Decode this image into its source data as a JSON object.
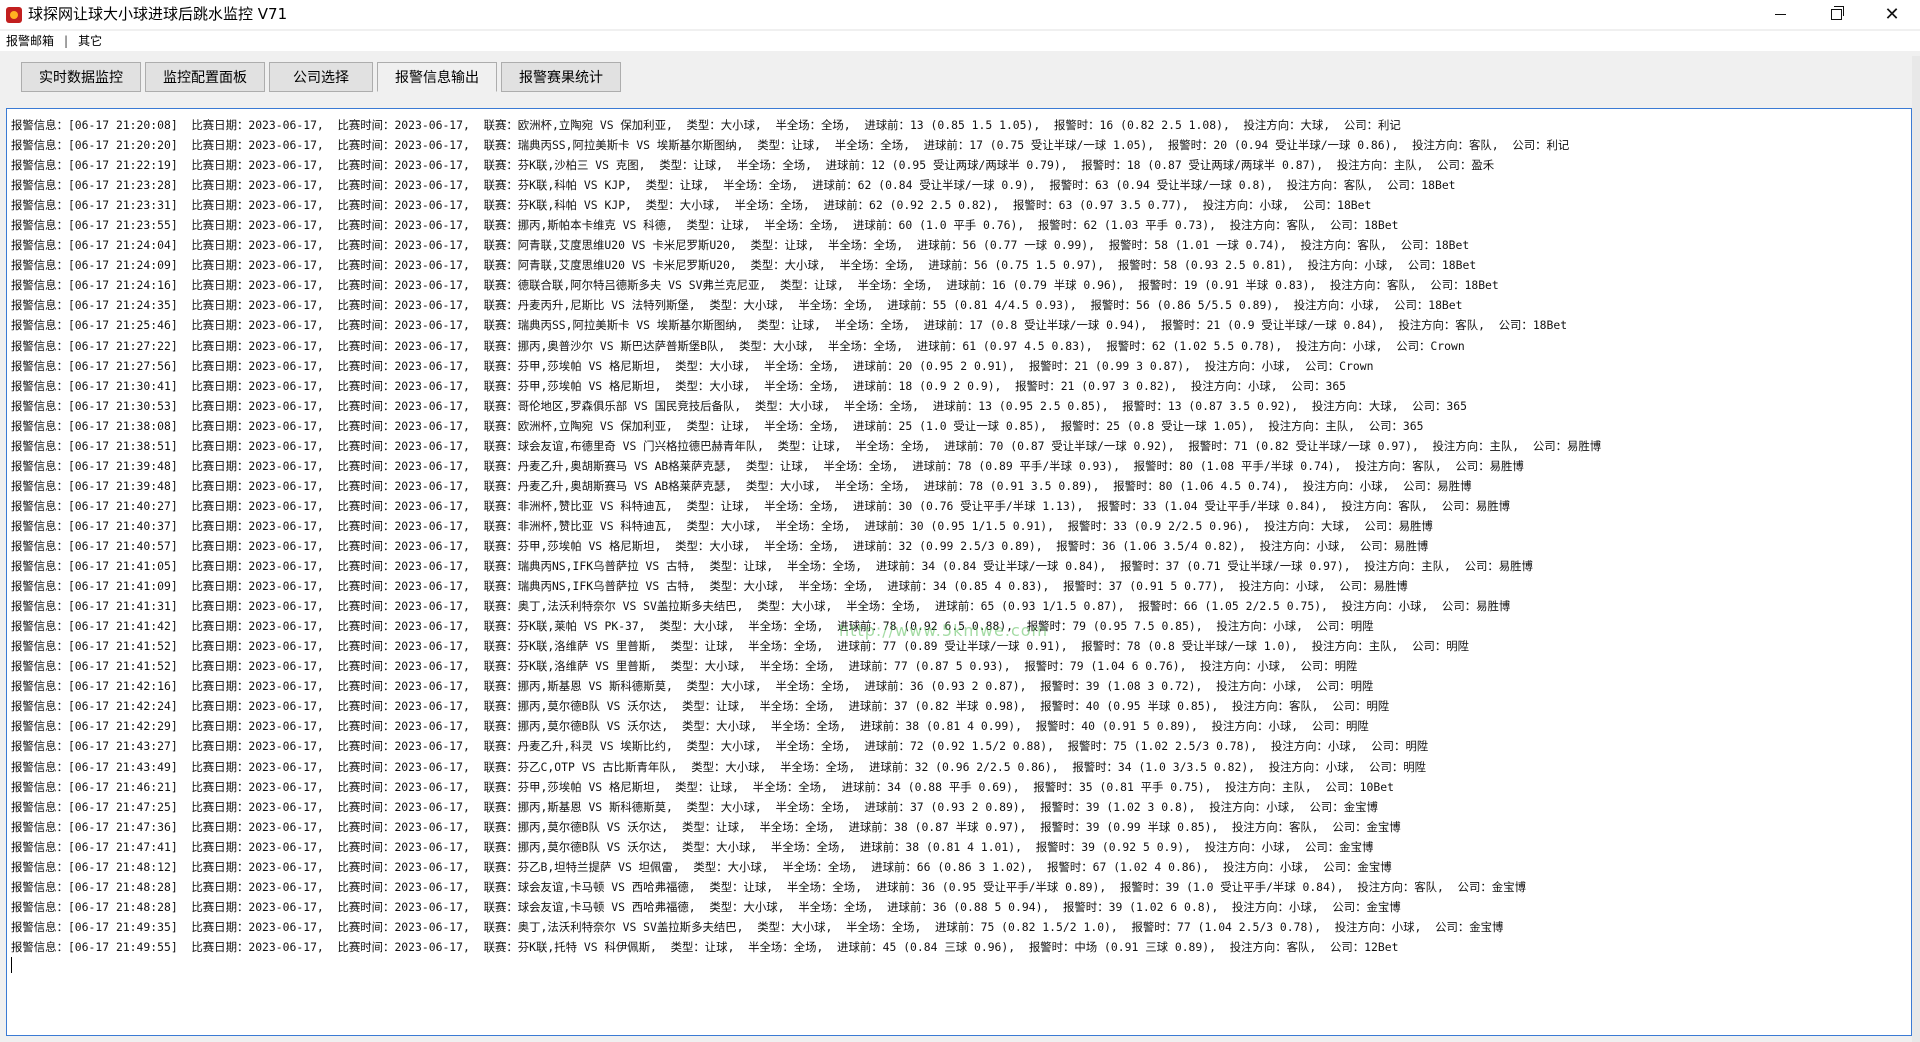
{
  "window": {
    "title": "球探网让球大小球进球后跳水监控 V71"
  },
  "menu": {
    "items": [
      {
        "label": "报警邮箱"
      },
      {
        "label": "其它"
      }
    ],
    "separator": "|"
  },
  "tabs": [
    {
      "label": "实时数据监控"
    },
    {
      "label": "监控配置面板"
    },
    {
      "label": "公司选择"
    },
    {
      "label": "报警信息输出",
      "active": true
    },
    {
      "label": "报警赛果统计"
    }
  ],
  "watermark": {
    "text": "http://www.5kmwe.com"
  },
  "log": {
    "lines": [
      "报警信息：[06-17 21:20:08]  比赛日期：2023-06-17,  比赛时间：2023-06-17,  联赛：欧洲杯,立陶宛 VS 保加利亚,  类型：大小球,  半全场：全场,  进球前：13 (0.85 1.5 1.05),  报警时：16 (0.82 2.5 1.08),  投注方向：大球,  公司：利记",
      "报警信息：[06-17 21:20:20]  比赛日期：2023-06-17,  比赛时间：2023-06-17,  联赛：瑞典丙SS,阿拉美斯卡 VS 埃斯基尔斯图纳,  类型：让球,  半全场：全场,  进球前：17 (0.75 受让半球/一球 1.05),  报警时：20 (0.94 受让半球/一球 0.86),  投注方向：客队,  公司：利记",
      "报警信息：[06-17 21:22:19]  比赛日期：2023-06-17,  比赛时间：2023-06-17,  联赛：芬K联,沙柏三 VS 克图,  类型：让球,  半全场：全场,  进球前：12 (0.95 受让两球/两球半 0.79),  报警时：18 (0.87 受让两球/两球半 0.87),  投注方向：主队,  公司：盈禾",
      "报警信息：[06-17 21:23:28]  比赛日期：2023-06-17,  比赛时间：2023-06-17,  联赛：芬K联,科帕 VS KJP,  类型：让球,  半全场：全场,  进球前：62 (0.84 受让半球/一球 0.9),  报警时：63 (0.94 受让半球/一球 0.8),  投注方向：客队,  公司：18Bet",
      "报警信息：[06-17 21:23:31]  比赛日期：2023-06-17,  比赛时间：2023-06-17,  联赛：芬K联,科帕 VS KJP,  类型：大小球,  半全场：全场,  进球前：62 (0.92 2.5 0.82),  报警时：63 (0.97 3.5 0.77),  投注方向：小球,  公司：18Bet",
      "报警信息：[06-17 21:23:55]  比赛日期：2023-06-17,  比赛时间：2023-06-17,  联赛：挪丙,斯帕本卡维克 VS 科德,  类型：让球,  半全场：全场,  进球前：60 (1.0 平手 0.76),  报警时：62 (1.03 平手 0.73),  投注方向：客队,  公司：18Bet",
      "报警信息：[06-17 21:24:04]  比赛日期：2023-06-17,  比赛时间：2023-06-17,  联赛：阿青联,艾度思维U20 VS 卡米尼罗斯U20,  类型：让球,  半全场：全场,  进球前：56 (0.77 一球 0.99),  报警时：58 (1.01 一球 0.74),  投注方向：客队,  公司：18Bet",
      "报警信息：[06-17 21:24:09]  比赛日期：2023-06-17,  比赛时间：2023-06-17,  联赛：阿青联,艾度思维U20 VS 卡米尼罗斯U20,  类型：大小球,  半全场：全场,  进球前：56 (0.75 1.5 0.97),  报警时：58 (0.93 2.5 0.81),  投注方向：小球,  公司：18Bet",
      "报警信息：[06-17 21:24:16]  比赛日期：2023-06-17,  比赛时间：2023-06-17,  联赛：德联合联,阿尔特吕德斯多夫 VS SV弗兰克尼亚,  类型：让球,  半全场：全场,  进球前：16 (0.79 半球 0.96),  报警时：19 (0.91 半球 0.83),  投注方向：客队,  公司：18Bet",
      "报警信息：[06-17 21:24:35]  比赛日期：2023-06-17,  比赛时间：2023-06-17,  联赛：丹麦丙升,尼斯比 VS 法特列斯堡,  类型：大小球,  半全场：全场,  进球前：55 (0.81 4/4.5 0.93),  报警时：56 (0.86 5/5.5 0.89),  投注方向：小球,  公司：18Bet",
      "报警信息：[06-17 21:25:46]  比赛日期：2023-06-17,  比赛时间：2023-06-17,  联赛：瑞典丙SS,阿拉美斯卡 VS 埃斯基尔斯图纳,  类型：让球,  半全场：全场,  进球前：17 (0.8 受让半球/一球 0.94),  报警时：21 (0.9 受让半球/一球 0.84),  投注方向：客队,  公司：18Bet",
      "报警信息：[06-17 21:27:22]  比赛日期：2023-06-17,  比赛时间：2023-06-17,  联赛：挪丙,奥普沙尔 VS 斯巴达萨普斯堡B队,  类型：大小球,  半全场：全场,  进球前：61 (0.97 4.5 0.83),  报警时：62 (1.02 5.5 0.78),  投注方向：小球,  公司：Crown",
      "报警信息：[06-17 21:27:56]  比赛日期：2023-06-17,  比赛时间：2023-06-17,  联赛：芬甲,莎埃帕 VS 格尼斯坦,  类型：大小球,  半全场：全场,  进球前：20 (0.95 2 0.91),  报警时：21 (0.99 3 0.87),  投注方向：小球,  公司：Crown",
      "报警信息：[06-17 21:30:41]  比赛日期：2023-06-17,  比赛时间：2023-06-17,  联赛：芬甲,莎埃帕 VS 格尼斯坦,  类型：大小球,  半全场：全场,  进球前：18 (0.9 2 0.9),  报警时：21 (0.97 3 0.82),  投注方向：小球,  公司：365",
      "报警信息：[06-17 21:30:53]  比赛日期：2023-06-17,  比赛时间：2023-06-17,  联赛：哥伦地区,罗森俱乐部 VS 国民竞技后备队,  类型：大小球,  半全场：全场,  进球前：13 (0.95 2.5 0.85),  报警时：13 (0.87 3.5 0.92),  投注方向：大球,  公司：365",
      "报警信息：[06-17 21:38:08]  比赛日期：2023-06-17,  比赛时间：2023-06-17,  联赛：欧洲杯,立陶宛 VS 保加利亚,  类型：让球,  半全场：全场,  进球前：25 (1.0 受让一球 0.85),  报警时：25 (0.8 受让一球 1.05),  投注方向：主队,  公司：365",
      "报警信息：[06-17 21:38:51]  比赛日期：2023-06-17,  比赛时间：2023-06-17,  联赛：球会友谊,布德里奇 VS 门兴格拉德巴赫青年队,  类型：让球,  半全场：全场,  进球前：70 (0.87 受让半球/一球 0.92),  报警时：71 (0.82 受让半球/一球 0.97),  投注方向：主队,  公司：易胜博",
      "报警信息：[06-17 21:39:48]  比赛日期：2023-06-17,  比赛时间：2023-06-17,  联赛：丹麦乙升,奥胡斯赛马 VS AB格莱萨克瑟,  类型：让球,  半全场：全场,  进球前：78 (0.89 平手/半球 0.93),  报警时：80 (1.08 平手/半球 0.74),  投注方向：客队,  公司：易胜博",
      "报警信息：[06-17 21:39:48]  比赛日期：2023-06-17,  比赛时间：2023-06-17,  联赛：丹麦乙升,奥胡斯赛马 VS AB格莱萨克瑟,  类型：大小球,  半全场：全场,  进球前：78 (0.91 3.5 0.89),  报警时：80 (1.06 4.5 0.74),  投注方向：小球,  公司：易胜博",
      "报警信息：[06-17 21:40:27]  比赛日期：2023-06-17,  比赛时间：2023-06-17,  联赛：非洲杯,赞比亚 VS 科特迪瓦,  类型：让球,  半全场：全场,  进球前：30 (0.76 受让平手/半球 1.13),  报警时：33 (1.04 受让平手/半球 0.84),  投注方向：客队,  公司：易胜博",
      "报警信息：[06-17 21:40:37]  比赛日期：2023-06-17,  比赛时间：2023-06-17,  联赛：非洲杯,赞比亚 VS 科特迪瓦,  类型：大小球,  半全场：全场,  进球前：30 (0.95 1/1.5 0.91),  报警时：33 (0.9 2/2.5 0.96),  投注方向：大球,  公司：易胜博",
      "报警信息：[06-17 21:40:57]  比赛日期：2023-06-17,  比赛时间：2023-06-17,  联赛：芬甲,莎埃帕 VS 格尼斯坦,  类型：大小球,  半全场：全场,  进球前：32 (0.99 2.5/3 0.89),  报警时：36 (1.06 3.5/4 0.82),  投注方向：小球,  公司：易胜博",
      "报警信息：[06-17 21:41:05]  比赛日期：2023-06-17,  比赛时间：2023-06-17,  联赛：瑞典丙NS,IFK乌普萨拉 VS 古特,  类型：让球,  半全场：全场,  进球前：34 (0.84 受让半球/一球 0.84),  报警时：37 (0.71 受让半球/一球 0.97),  投注方向：主队,  公司：易胜博",
      "报警信息：[06-17 21:41:09]  比赛日期：2023-06-17,  比赛时间：2023-06-17,  联赛：瑞典丙NS,IFK乌普萨拉 VS 古特,  类型：大小球,  半全场：全场,  进球前：34 (0.85 4 0.83),  报警时：37 (0.91 5 0.77),  投注方向：小球,  公司：易胜博",
      "报警信息：[06-17 21:41:31]  比赛日期：2023-06-17,  比赛时间：2023-06-17,  联赛：奥丁,法沃利特奈尔 VS SV盖拉斯多夫结巴,  类型：大小球,  半全场：全场,  进球前：65 (0.93 1/1.5 0.87),  报警时：66 (1.05 2/2.5 0.75),  投注方向：小球,  公司：易胜博",
      "报警信息：[06-17 21:41:42]  比赛日期：2023-06-17,  比赛时间：2023-06-17,  联赛：芬K联,莱帕 VS PK-37,  类型：大小球,  半全场：全场,  进球前：78 (0.92 6.5 0.88),  报警时：79 (0.95 7.5 0.85),  投注方向：小球,  公司：明陞",
      "报警信息：[06-17 21:41:52]  比赛日期：2023-06-17,  比赛时间：2023-06-17,  联赛：芬K联,洛维萨 VS 里普斯,  类型：让球,  半全场：全场,  进球前：77 (0.89 受让半球/一球 0.91),  报警时：78 (0.8 受让半球/一球 1.0),  投注方向：主队,  公司：明陞",
      "报警信息：[06-17 21:41:52]  比赛日期：2023-06-17,  比赛时间：2023-06-17,  联赛：芬K联,洛维萨 VS 里普斯,  类型：大小球,  半全场：全场,  进球前：77 (0.87 5 0.93),  报警时：79 (1.04 6 0.76),  投注方向：小球,  公司：明陞",
      "报警信息：[06-17 21:42:16]  比赛日期：2023-06-17,  比赛时间：2023-06-17,  联赛：挪丙,斯基恩 VS 斯科德斯莫,  类型：大小球,  半全场：全场,  进球前：36 (0.93 2 0.87),  报警时：39 (1.08 3 0.72),  投注方向：小球,  公司：明陞",
      "报警信息：[06-17 21:42:24]  比赛日期：2023-06-17,  比赛时间：2023-06-17,  联赛：挪丙,莫尔德B队 VS 沃尔达,  类型：让球,  半全场：全场,  进球前：37 (0.82 半球 0.98),  报警时：40 (0.95 半球 0.85),  投注方向：客队,  公司：明陞",
      "报警信息：[06-17 21:42:29]  比赛日期：2023-06-17,  比赛时间：2023-06-17,  联赛：挪丙,莫尔德B队 VS 沃尔达,  类型：大小球,  半全场：全场,  进球前：38 (0.81 4 0.99),  报警时：40 (0.91 5 0.89),  投注方向：小球,  公司：明陞",
      "报警信息：[06-17 21:43:27]  比赛日期：2023-06-17,  比赛时间：2023-06-17,  联赛：丹麦乙升,科灵 VS 埃斯比约,  类型：大小球,  半全场：全场,  进球前：72 (0.92 1.5/2 0.88),  报警时：75 (1.02 2.5/3 0.78),  投注方向：小球,  公司：明陞",
      "报警信息：[06-17 21:43:49]  比赛日期：2023-06-17,  比赛时间：2023-06-17,  联赛：芬乙C,OTP VS 古比斯青年队,  类型：大小球,  半全场：全场,  进球前：32 (0.96 2/2.5 0.86),  报警时：34 (1.0 3/3.5 0.82),  投注方向：小球,  公司：明陞",
      "报警信息：[06-17 21:46:21]  比赛日期：2023-06-17,  比赛时间：2023-06-17,  联赛：芬甲,莎埃帕 VS 格尼斯坦,  类型：让球,  半全场：全场,  进球前：34 (0.88 平手 0.69),  报警时：35 (0.81 平手 0.75),  投注方向：主队,  公司：10Bet",
      "报警信息：[06-17 21:47:25]  比赛日期：2023-06-17,  比赛时间：2023-06-17,  联赛：挪丙,斯基恩 VS 斯科德斯莫,  类型：大小球,  半全场：全场,  进球前：37 (0.93 2 0.89),  报警时：39 (1.02 3 0.8),  投注方向：小球,  公司：金宝博",
      "报警信息：[06-17 21:47:36]  比赛日期：2023-06-17,  比赛时间：2023-06-17,  联赛：挪丙,莫尔德B队 VS 沃尔达,  类型：让球,  半全场：全场,  进球前：38 (0.87 半球 0.97),  报警时：39 (0.99 半球 0.85),  投注方向：客队,  公司：金宝博",
      "报警信息：[06-17 21:47:41]  比赛日期：2023-06-17,  比赛时间：2023-06-17,  联赛：挪丙,莫尔德B队 VS 沃尔达,  类型：大小球,  半全场：全场,  进球前：38 (0.81 4 1.01),  报警时：39 (0.92 5 0.9),  投注方向：小球,  公司：金宝博",
      "报警信息：[06-17 21:48:12]  比赛日期：2023-06-17,  比赛时间：2023-06-17,  联赛：芬乙B,坦特兰提萨 VS 坦佩雷,  类型：大小球,  半全场：全场,  进球前：66 (0.86 3 1.02),  报警时：67 (1.02 4 0.86),  投注方向：小球,  公司：金宝博",
      "报警信息：[06-17 21:48:28]  比赛日期：2023-06-17,  比赛时间：2023-06-17,  联赛：球会友谊,卡马顿 VS 西哈弗福德,  类型：让球,  半全场：全场,  进球前：36 (0.95 受让平手/半球 0.89),  报警时：39 (1.0 受让平手/半球 0.84),  投注方向：客队,  公司：金宝博",
      "报警信息：[06-17 21:48:28]  比赛日期：2023-06-17,  比赛时间：2023-06-17,  联赛：球会友谊,卡马顿 VS 西哈弗福德,  类型：大小球,  半全场：全场,  进球前：36 (0.88 5 0.94),  报警时：39 (1.02 6 0.8),  投注方向：小球,  公司：金宝博",
      "报警信息：[06-17 21:49:35]  比赛日期：2023-06-17,  比赛时间：2023-06-17,  联赛：奥丁,法沃利特奈尔 VS SV盖拉斯多夫结巴,  类型：大小球,  半全场：全场,  进球前：75 (0.82 1.5/2 1.0),  报警时：77 (1.04 2.5/3 0.78),  投注方向：小球,  公司：金宝博",
      "报警信息：[06-17 21:49:55]  比赛日期：2023-06-17,  比赛时间：2023-06-17,  联赛：芬K联,托特 VS 科伊佩斯,  类型：让球,  半全场：全场,  进球前：45 (0.84 三球 0.96),  报警时：中场 (0.91 三球 0.89),  投注方向：客队,  公司：12Bet"
    ]
  }
}
